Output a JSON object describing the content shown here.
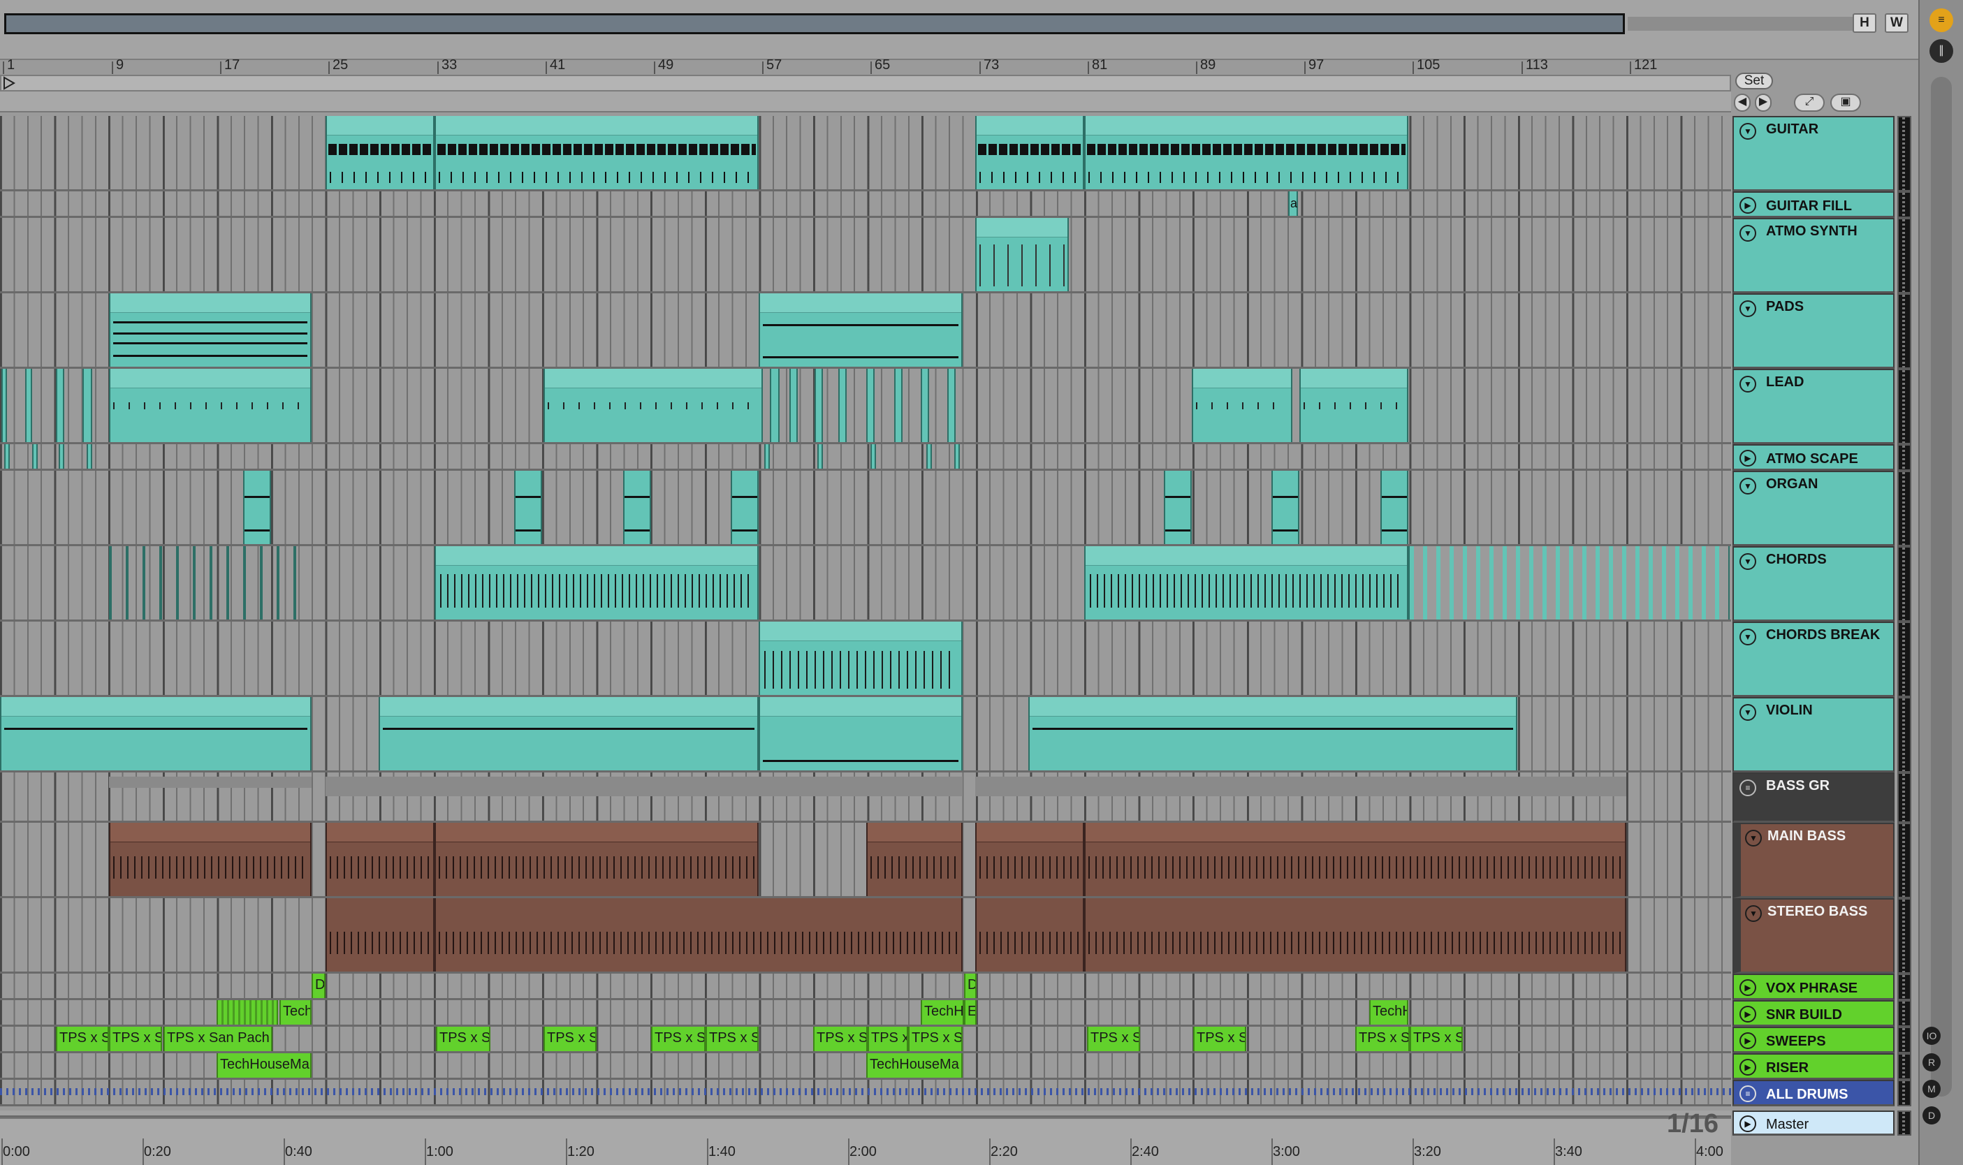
{
  "overview": {
    "h_button": "H",
    "w_button": "W"
  },
  "ruler": {
    "bars": [
      "1",
      "9",
      "17",
      "25",
      "33",
      "41",
      "49",
      "57",
      "65",
      "73",
      "81",
      "89",
      "97",
      "105",
      "113",
      "121"
    ]
  },
  "set_button": "Set",
  "tracks": [
    {
      "name": "GUITAR",
      "color": "#63c4b6"
    },
    {
      "name": "GUITAR FILL",
      "color": "#63c4b6"
    },
    {
      "name": "ATMO SYNTH",
      "color": "#63c4b6"
    },
    {
      "name": "PADS",
      "color": "#63c4b6"
    },
    {
      "name": "LEAD",
      "color": "#63c4b6"
    },
    {
      "name": "ATMO SCAPE",
      "color": "#63c4b6"
    },
    {
      "name": "ORGAN",
      "color": "#63c4b6"
    },
    {
      "name": "CHORDS",
      "color": "#63c4b6"
    },
    {
      "name": "CHORDS BREAK",
      "color": "#63c4b6"
    },
    {
      "name": "VIOLIN",
      "color": "#63c4b6"
    },
    {
      "name": "BASS GR",
      "color": "#3d3d3d"
    },
    {
      "name": "MAIN BASS",
      "color": "#7a5245"
    },
    {
      "name": "STEREO BASS",
      "color": "#7a5245"
    },
    {
      "name": "VOX PHRASE",
      "color": "#62d12c"
    },
    {
      "name": "SNR BUILD",
      "color": "#62d12c"
    },
    {
      "name": "SWEEPS",
      "color": "#62d12c"
    },
    {
      "name": "RISER",
      "color": "#62d12c"
    },
    {
      "name": "ALL DRUMS",
      "color": "#3b55a8"
    },
    {
      "name": "Master",
      "color": "#cfe8f8"
    }
  ],
  "clip_labels": {
    "guitar_fill": "a",
    "vox_1": "D",
    "vox_2": "D",
    "snr_1": "Tech",
    "snr_2": "TechH",
    "snr_3": "E",
    "snr_4": "TechH",
    "sw_1": "TPS x S",
    "sw_2": "TPS x S",
    "sw_3": "TPS x San Pach",
    "sw_4": "TPS x S",
    "sw_5": "TPS x S",
    "sw_6": "TPS x S",
    "sw_7": "TPS x S",
    "sw_8": "TPS x S",
    "sw_9": "TPS x S",
    "sw_10": "TPS x S",
    "sw_11": "TPS x S",
    "sw_12": "TPS x S",
    "sw_13": "TPS x S",
    "sw_14": "TPS x S",
    "riser_1": "TechHouseMa",
    "riser_2": "TechHouseMa"
  },
  "timeline": {
    "labels": [
      "0:00",
      "0:20",
      "0:40",
      "1:00",
      "1:20",
      "1:40",
      "2:00",
      "2:20",
      "2:40",
      "3:00",
      "3:20",
      "3:40",
      "4:00"
    ]
  },
  "zoom": "1/16"
}
